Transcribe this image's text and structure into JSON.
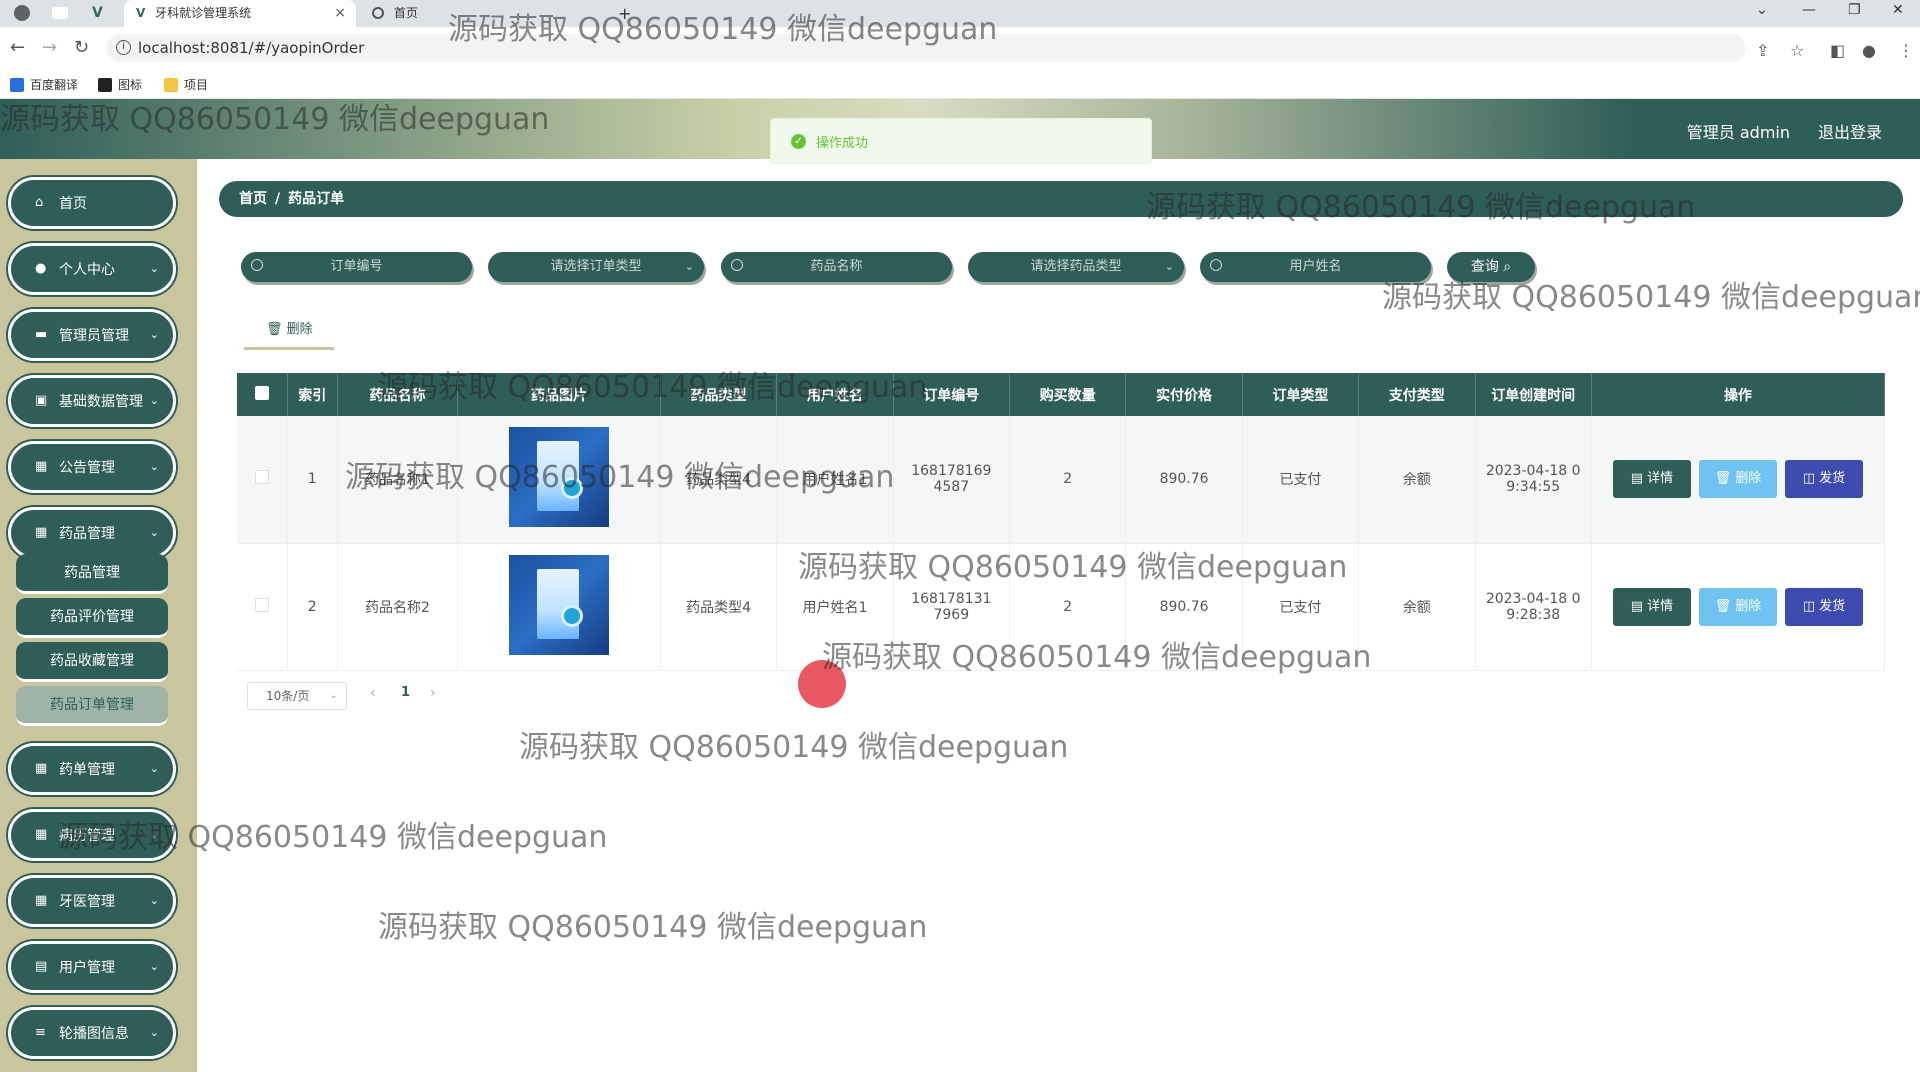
{
  "browser": {
    "tabs": [
      {
        "title": "牙科就诊管理系统",
        "close": "×"
      },
      {
        "title": "首页"
      }
    ],
    "new_tab": "+",
    "url": "localhost:8081/#/yaopinOrder",
    "bookmarks": [
      "百度翻译",
      "图标",
      "项目"
    ],
    "window_controls": [
      "⌄",
      "—",
      "❐",
      "✕"
    ]
  },
  "header": {
    "user": "管理员 admin",
    "logout": "退出登录"
  },
  "toast": {
    "message": "操作成功",
    "color": "#67c23a"
  },
  "sidebar": {
    "items": [
      {
        "label": "首页",
        "icon": "home-icon"
      },
      {
        "label": "个人中心",
        "icon": "user-icon"
      },
      {
        "label": "管理员管理",
        "icon": "monitor-icon"
      },
      {
        "label": "基础数据管理",
        "icon": "chart-icon"
      },
      {
        "label": "公告管理",
        "icon": "grid-icon"
      },
      {
        "label": "药品管理",
        "icon": "grid-icon"
      },
      {
        "label": "药单管理",
        "icon": "grid-icon"
      },
      {
        "label": "病历管理",
        "icon": "grid-icon"
      },
      {
        "label": "牙医管理",
        "icon": "grid-icon"
      },
      {
        "label": "用户管理",
        "icon": "clipboard-icon"
      },
      {
        "label": "轮播图信息",
        "icon": "menu-icon"
      }
    ],
    "sub_items": [
      "药品管理",
      "药品评价管理",
      "药品收藏管理",
      "药品订单管理"
    ]
  },
  "breadcrumb": {
    "home": "首页",
    "separator": "/",
    "current": "药品订单"
  },
  "search": {
    "order_no": "订单编号",
    "order_type": "请选择订单类型",
    "drug_name": "药品名称",
    "drug_type": "请选择药品类型",
    "user_name": "用户姓名",
    "query": "查询"
  },
  "toolbar": {
    "delete": "删除"
  },
  "table": {
    "headers": [
      "索引",
      "药品名称",
      "药品图片",
      "药品类型",
      "用户姓名",
      "订单编号",
      "购买数量",
      "实付价格",
      "订单类型",
      "支付类型",
      "订单创建时间",
      "操作"
    ],
    "rows": [
      {
        "index": "1",
        "name": "药品名称1",
        "type": "药品类型4",
        "user": "用户姓名1",
        "order_no": "1681781694587",
        "qty": "2",
        "price": "890.76",
        "order_type": "已支付",
        "pay_type": "余额",
        "created": "2023-04-18 09:34:55"
      },
      {
        "index": "2",
        "name": "药品名称2",
        "type": "药品类型4",
        "user": "用户姓名1",
        "order_no": "1681781317969",
        "qty": "2",
        "price": "890.76",
        "order_type": "已支付",
        "pay_type": "余额",
        "created": "2023-04-18 09:28:38"
      }
    ],
    "actions": {
      "detail": "详情",
      "delete": "删除",
      "ship": "发货"
    }
  },
  "pager": {
    "size": "10条/页",
    "prev": "‹",
    "page": "1",
    "next": "›"
  },
  "watermark": "源码获取 QQ86050149 微信deepguan",
  "colors": {
    "primary": "#2f5e58",
    "sidebar_bg": "#c9c59c",
    "delete_btn": "#6fc3f0",
    "ship_btn": "#3e4bb0"
  }
}
